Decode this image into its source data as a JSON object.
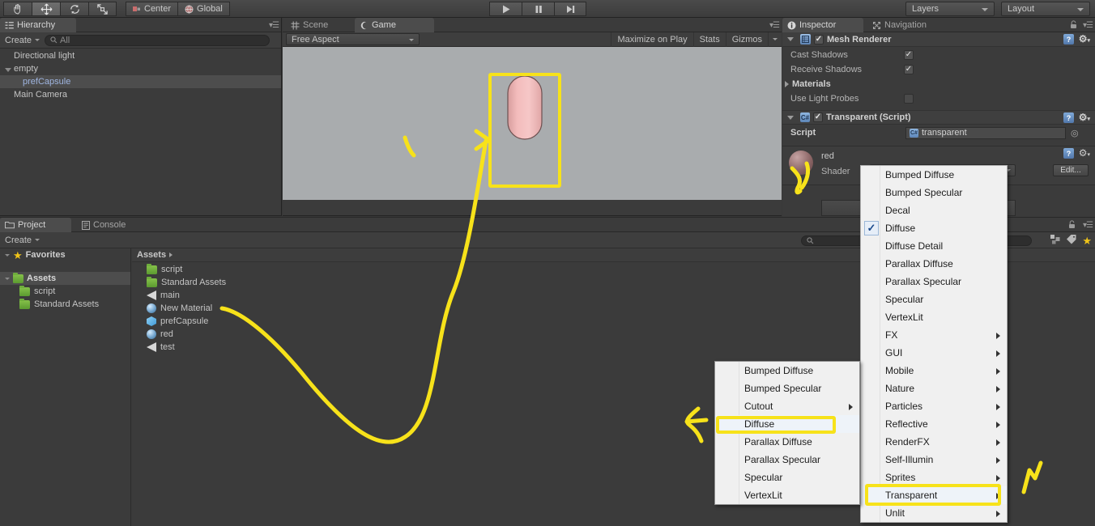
{
  "toolbar": {
    "tools": [
      {
        "name": "hand-tool",
        "label": "Hand"
      },
      {
        "name": "move-tool",
        "label": "Move"
      },
      {
        "name": "rotate-tool",
        "label": "Rotate"
      },
      {
        "name": "scale-tool",
        "label": "Scale"
      }
    ],
    "pivot_mode": "Center",
    "pivot_rotation": "Global",
    "play": "Play",
    "pause": "Pause",
    "step": "Step",
    "layers": "Layers",
    "layout": "Layout"
  },
  "hierarchy": {
    "tab": "Hierarchy",
    "create": "Create",
    "search_placeholder": "All",
    "items": [
      {
        "label": "Directional light",
        "indent": 0,
        "selected": false,
        "fold": "none"
      },
      {
        "label": "empty",
        "indent": 0,
        "selected": false,
        "fold": "open"
      },
      {
        "label": "prefCapsule",
        "indent": 1,
        "selected": true,
        "fold": "none"
      },
      {
        "label": "Main Camera",
        "indent": 0,
        "selected": false,
        "fold": "none"
      }
    ]
  },
  "gameview": {
    "tabs": [
      {
        "label": "Scene",
        "active": false,
        "icon": "grid-icon"
      },
      {
        "label": "Game",
        "active": true,
        "icon": "gamepad-icon"
      }
    ],
    "aspect": "Free Aspect",
    "maximize_on_play": "Maximize on Play",
    "stats": "Stats",
    "gizmos": "Gizmos",
    "bg_color": "#a9acae",
    "capsule_color": "#f0b6b6"
  },
  "inspector": {
    "tabs": [
      {
        "label": "Inspector",
        "active": true,
        "icon": "info-icon"
      },
      {
        "label": "Navigation",
        "active": false,
        "icon": "navigation-icon"
      }
    ],
    "components": [
      {
        "title": "Mesh Renderer",
        "enabled": true,
        "rows": [
          {
            "label": "Cast Shadows",
            "type": "checkbox",
            "value": true
          },
          {
            "label": "Receive Shadows",
            "type": "checkbox",
            "value": true
          },
          {
            "label": "Materials",
            "type": "foldout",
            "value": ""
          },
          {
            "label": "Use Light Probes",
            "type": "checkbox",
            "value": false
          }
        ]
      },
      {
        "title": "Transparent (Script)",
        "enabled": true,
        "rows": [
          {
            "label": "Script",
            "type": "object",
            "value": "transparent"
          }
        ]
      }
    ],
    "material": {
      "name": "red",
      "shader_label": "Shader",
      "shader_value": "Diffuse",
      "edit_button": "Edit..."
    }
  },
  "project": {
    "tabs": [
      {
        "label": "Project",
        "active": true,
        "icon": "folder-icon"
      },
      {
        "label": "Console",
        "active": false,
        "icon": "console-icon"
      }
    ],
    "create": "Create",
    "search_placeholder": "",
    "favorites": "Favorites",
    "tree": [
      {
        "label": "Assets",
        "indent": 0,
        "selected": true,
        "icon": "folder-icon",
        "fold": "open"
      },
      {
        "label": "script",
        "indent": 1,
        "selected": false,
        "icon": "folder-icon",
        "fold": "none"
      },
      {
        "label": "Standard Assets",
        "indent": 1,
        "selected": false,
        "icon": "folder-icon",
        "fold": "none"
      }
    ],
    "breadcrumb": "Assets",
    "assets": [
      {
        "label": "script",
        "icon": "folder-icon"
      },
      {
        "label": "Standard Assets",
        "icon": "folder-icon"
      },
      {
        "label": "main",
        "icon": "script-icon"
      },
      {
        "label": "New Material",
        "icon": "material-icon"
      },
      {
        "label": "prefCapsule",
        "icon": "prefab-icon"
      },
      {
        "label": "red",
        "icon": "material-icon"
      },
      {
        "label": "test",
        "icon": "script-icon"
      }
    ]
  },
  "shader_menu": {
    "items": [
      {
        "label": "Bumped Diffuse",
        "submenu": false,
        "checked": false
      },
      {
        "label": "Bumped Specular",
        "submenu": false,
        "checked": false
      },
      {
        "label": "Decal",
        "submenu": false,
        "checked": false
      },
      {
        "label": "Diffuse",
        "submenu": false,
        "checked": true
      },
      {
        "label": "Diffuse Detail",
        "submenu": false,
        "checked": false
      },
      {
        "label": "Parallax Diffuse",
        "submenu": false,
        "checked": false
      },
      {
        "label": "Parallax Specular",
        "submenu": false,
        "checked": false
      },
      {
        "label": "Specular",
        "submenu": false,
        "checked": false
      },
      {
        "label": "VertexLit",
        "submenu": false,
        "checked": false
      },
      {
        "label": "FX",
        "submenu": true,
        "checked": false
      },
      {
        "label": "GUI",
        "submenu": true,
        "checked": false
      },
      {
        "label": "Mobile",
        "submenu": true,
        "checked": false
      },
      {
        "label": "Nature",
        "submenu": true,
        "checked": false
      },
      {
        "label": "Particles",
        "submenu": true,
        "checked": false
      },
      {
        "label": "Reflective",
        "submenu": true,
        "checked": false
      },
      {
        "label": "RenderFX",
        "submenu": true,
        "checked": false
      },
      {
        "label": "Self-Illumin",
        "submenu": true,
        "checked": false
      },
      {
        "label": "Sprites",
        "submenu": true,
        "checked": false
      },
      {
        "label": "Transparent",
        "submenu": true,
        "checked": false,
        "highlighted": true
      },
      {
        "label": "Unlit",
        "submenu": true,
        "checked": false
      }
    ]
  },
  "transparent_submenu": {
    "items": [
      {
        "label": "Bumped Diffuse",
        "submenu": false
      },
      {
        "label": "Bumped Specular",
        "submenu": false
      },
      {
        "label": "Cutout",
        "submenu": true
      },
      {
        "label": "Diffuse",
        "submenu": false,
        "highlighted": true
      },
      {
        "label": "Parallax Diffuse",
        "submenu": false
      },
      {
        "label": "Parallax Specular",
        "submenu": false
      },
      {
        "label": "Specular",
        "submenu": false
      },
      {
        "label": "VertexLit",
        "submenu": false
      }
    ]
  },
  "annotations": {
    "highlight_color": "#f7e21a",
    "marks": [
      "game-capsule-box",
      "arrow-to-capsule",
      "material-ball-mark",
      "submenu-diffuse-box",
      "transparent-item-box",
      "left-caret-mark",
      "right-caret-mark",
      "curve-from-new-material"
    ]
  }
}
